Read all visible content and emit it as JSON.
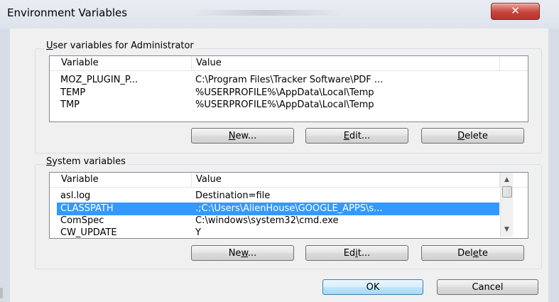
{
  "window": {
    "title": "Environment Variables",
    "close_label": "✕"
  },
  "user_vars": {
    "group_label": "User variables for Administrator",
    "group_label_accel": "U",
    "group_label_rest": "ser variables for Administrator",
    "columns": [
      "Variable",
      "Value"
    ],
    "rows": [
      {
        "variable": "MOZ_PLUGIN_P...",
        "value": "C:\\Program Files\\Tracker Software\\PDF ..."
      },
      {
        "variable": "TEMP",
        "value": "%USERPROFILE%\\AppData\\Local\\Temp"
      },
      {
        "variable": "TMP",
        "value": "%USERPROFILE%\\AppData\\Local\\Temp"
      }
    ],
    "buttons": {
      "new_accel": "N",
      "new_rest": "ew...",
      "edit_accel": "E",
      "edit_rest": "dit...",
      "delete_accel": "D",
      "delete_rest": "elete"
    }
  },
  "system_vars": {
    "group_label_accel": "S",
    "group_label_rest": "ystem variables",
    "columns": [
      "Variable",
      "Value"
    ],
    "rows": [
      {
        "variable": "asl.log",
        "value": "Destination=file",
        "selected": false
      },
      {
        "variable": "CLASSPATH",
        "value": ".;C:\\Users\\AlienHouse\\GOOGLE_APPS\\s...",
        "selected": true
      },
      {
        "variable": "ComSpec",
        "value": "C:\\windows\\system32\\cmd.exe",
        "selected": false
      },
      {
        "variable": "CW_UPDATE",
        "value": "Y",
        "selected": false
      }
    ],
    "buttons": {
      "new_pre": "Ne",
      "new_accel": "w",
      "new_rest": "...",
      "edit_pre": "Ed",
      "edit_accel": "i",
      "edit_rest": "t...",
      "delete_pre": "Del",
      "delete_accel": "e",
      "delete_rest": "te"
    },
    "scroll_up": "▲",
    "scroll_down": "▼"
  },
  "footer": {
    "ok_label": "OK",
    "cancel_label": "Cancel"
  },
  "colors": {
    "selection": "#3399ff",
    "close_button": "#c7443a",
    "default_button_border": "#3c7fb1"
  }
}
